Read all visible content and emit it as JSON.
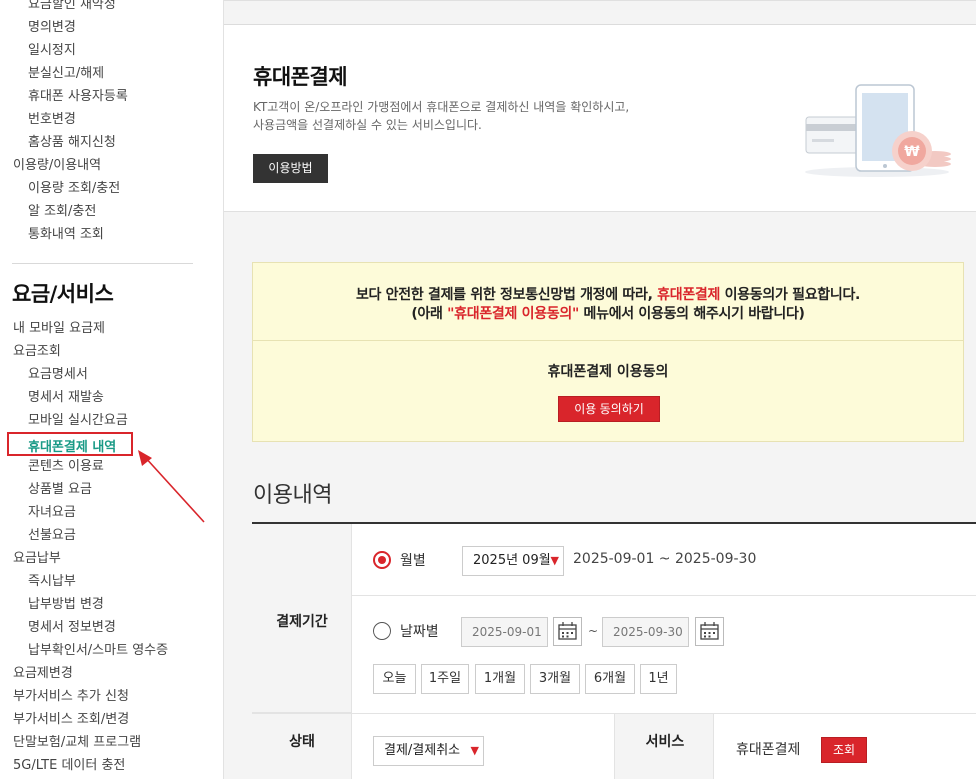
{
  "sidebar": {
    "items_top": [
      "요금할인 재약정",
      "명의변경",
      "일시정지",
      "분실신고/해제",
      "휴대폰 사용자등록",
      "번호변경",
      "홈상품 해지신청"
    ],
    "group_usage": "이용량/이용내역",
    "items_usage": [
      "이용량 조회/충전",
      "알 조회/충전",
      "통화내역 조회"
    ],
    "heading": "요금/서비스",
    "my_mobile_fee": "내 모바일 요금제",
    "group_bill": "요금조회",
    "items_bill": [
      "요금명세서",
      "명세서 재발송",
      "모바일 실시간요금"
    ],
    "active_item": "휴대폰결제 내역",
    "items_bill2": [
      "콘텐츠 이용료",
      "상품별 요금",
      "자녀요금",
      "선불요금"
    ],
    "group_pay": "요금납부",
    "items_pay": [
      "즉시납부",
      "납부방법 변경",
      "명세서 정보변경",
      "납부확인서/스마트 영수증"
    ],
    "items_bottom": [
      "요금제변경",
      "부가서비스 추가 신청",
      "부가서비스 조회/변경",
      "단말보험/교체 프로그램",
      "5G/LTE 데이터 충전"
    ]
  },
  "header": {
    "title": "휴대폰결제",
    "desc_line1": "KT고객이 온/오프라인 가맹점에서 휴대폰으로 결제하신 내역을 확인하시고,",
    "desc_line2": "사용금액을 선결제하실 수 있는 서비스입니다.",
    "howto_button": "이용방법"
  },
  "notice": {
    "line1_a": "보다 안전한 결제를 위한 정보통신망법 개정에 따라, ",
    "line1_red": "휴대폰결제",
    "line1_b": " 이용동의가 필요합니다.",
    "line2_a": "(아래 ",
    "line2_red": "\"휴대폰결제 이용동의\"",
    "line2_b": " 메뉴에서 이용동의 해주시기 바랍니다)",
    "consent_title": "휴대폰결제 이용동의",
    "consent_button": "이용 동의하기"
  },
  "usage": {
    "section_title": "이용내역",
    "period_label": "결제기간",
    "monthly_label": "월별",
    "month_select": "2025년 09월",
    "month_range": "2025-09-01 ~ 2025-09-30",
    "daily_label": "날짜별",
    "date_from": "2025-09-01",
    "tilde": "~",
    "date_to": "2025-09-30",
    "period_buttons": [
      "오늘",
      "1주일",
      "1개월",
      "3개월",
      "6개월",
      "1년"
    ],
    "status_label": "상태",
    "status_select": "결제/결제취소",
    "service_label": "서비스",
    "service_value": "휴대폰결제",
    "search_button": "조회"
  },
  "colors": {
    "accent_red": "#d9252b",
    "active_teal": "#1a9a86",
    "notice_bg": "#fdfbd9"
  }
}
